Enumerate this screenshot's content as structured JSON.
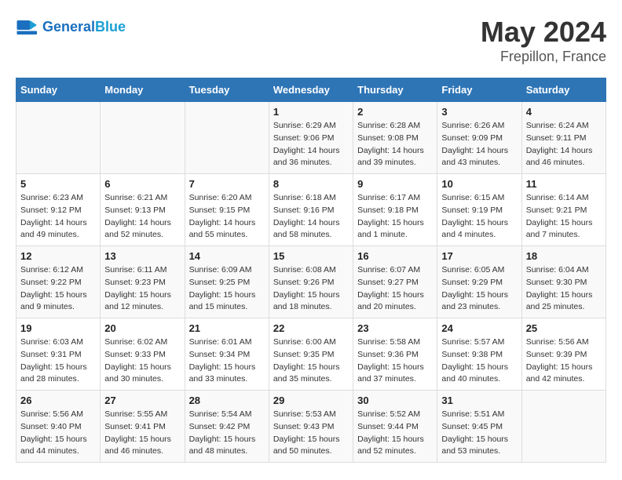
{
  "header": {
    "logo_general": "General",
    "logo_blue": "Blue",
    "month_title": "May 2024",
    "location": "Frepillon, France"
  },
  "weekdays": [
    "Sunday",
    "Monday",
    "Tuesday",
    "Wednesday",
    "Thursday",
    "Friday",
    "Saturday"
  ],
  "weeks": [
    [
      {
        "day": "",
        "sunrise": "",
        "sunset": "",
        "daylight": ""
      },
      {
        "day": "",
        "sunrise": "",
        "sunset": "",
        "daylight": ""
      },
      {
        "day": "",
        "sunrise": "",
        "sunset": "",
        "daylight": ""
      },
      {
        "day": "1",
        "sunrise": "Sunrise: 6:29 AM",
        "sunset": "Sunset: 9:06 PM",
        "daylight": "Daylight: 14 hours and 36 minutes."
      },
      {
        "day": "2",
        "sunrise": "Sunrise: 6:28 AM",
        "sunset": "Sunset: 9:08 PM",
        "daylight": "Daylight: 14 hours and 39 minutes."
      },
      {
        "day": "3",
        "sunrise": "Sunrise: 6:26 AM",
        "sunset": "Sunset: 9:09 PM",
        "daylight": "Daylight: 14 hours and 43 minutes."
      },
      {
        "day": "4",
        "sunrise": "Sunrise: 6:24 AM",
        "sunset": "Sunset: 9:11 PM",
        "daylight": "Daylight: 14 hours and 46 minutes."
      }
    ],
    [
      {
        "day": "5",
        "sunrise": "Sunrise: 6:23 AM",
        "sunset": "Sunset: 9:12 PM",
        "daylight": "Daylight: 14 hours and 49 minutes."
      },
      {
        "day": "6",
        "sunrise": "Sunrise: 6:21 AM",
        "sunset": "Sunset: 9:13 PM",
        "daylight": "Daylight: 14 hours and 52 minutes."
      },
      {
        "day": "7",
        "sunrise": "Sunrise: 6:20 AM",
        "sunset": "Sunset: 9:15 PM",
        "daylight": "Daylight: 14 hours and 55 minutes."
      },
      {
        "day": "8",
        "sunrise": "Sunrise: 6:18 AM",
        "sunset": "Sunset: 9:16 PM",
        "daylight": "Daylight: 14 hours and 58 minutes."
      },
      {
        "day": "9",
        "sunrise": "Sunrise: 6:17 AM",
        "sunset": "Sunset: 9:18 PM",
        "daylight": "Daylight: 15 hours and 1 minute."
      },
      {
        "day": "10",
        "sunrise": "Sunrise: 6:15 AM",
        "sunset": "Sunset: 9:19 PM",
        "daylight": "Daylight: 15 hours and 4 minutes."
      },
      {
        "day": "11",
        "sunrise": "Sunrise: 6:14 AM",
        "sunset": "Sunset: 9:21 PM",
        "daylight": "Daylight: 15 hours and 7 minutes."
      }
    ],
    [
      {
        "day": "12",
        "sunrise": "Sunrise: 6:12 AM",
        "sunset": "Sunset: 9:22 PM",
        "daylight": "Daylight: 15 hours and 9 minutes."
      },
      {
        "day": "13",
        "sunrise": "Sunrise: 6:11 AM",
        "sunset": "Sunset: 9:23 PM",
        "daylight": "Daylight: 15 hours and 12 minutes."
      },
      {
        "day": "14",
        "sunrise": "Sunrise: 6:09 AM",
        "sunset": "Sunset: 9:25 PM",
        "daylight": "Daylight: 15 hours and 15 minutes."
      },
      {
        "day": "15",
        "sunrise": "Sunrise: 6:08 AM",
        "sunset": "Sunset: 9:26 PM",
        "daylight": "Daylight: 15 hours and 18 minutes."
      },
      {
        "day": "16",
        "sunrise": "Sunrise: 6:07 AM",
        "sunset": "Sunset: 9:27 PM",
        "daylight": "Daylight: 15 hours and 20 minutes."
      },
      {
        "day": "17",
        "sunrise": "Sunrise: 6:05 AM",
        "sunset": "Sunset: 9:29 PM",
        "daylight": "Daylight: 15 hours and 23 minutes."
      },
      {
        "day": "18",
        "sunrise": "Sunrise: 6:04 AM",
        "sunset": "Sunset: 9:30 PM",
        "daylight": "Daylight: 15 hours and 25 minutes."
      }
    ],
    [
      {
        "day": "19",
        "sunrise": "Sunrise: 6:03 AM",
        "sunset": "Sunset: 9:31 PM",
        "daylight": "Daylight: 15 hours and 28 minutes."
      },
      {
        "day": "20",
        "sunrise": "Sunrise: 6:02 AM",
        "sunset": "Sunset: 9:33 PM",
        "daylight": "Daylight: 15 hours and 30 minutes."
      },
      {
        "day": "21",
        "sunrise": "Sunrise: 6:01 AM",
        "sunset": "Sunset: 9:34 PM",
        "daylight": "Daylight: 15 hours and 33 minutes."
      },
      {
        "day": "22",
        "sunrise": "Sunrise: 6:00 AM",
        "sunset": "Sunset: 9:35 PM",
        "daylight": "Daylight: 15 hours and 35 minutes."
      },
      {
        "day": "23",
        "sunrise": "Sunrise: 5:58 AM",
        "sunset": "Sunset: 9:36 PM",
        "daylight": "Daylight: 15 hours and 37 minutes."
      },
      {
        "day": "24",
        "sunrise": "Sunrise: 5:57 AM",
        "sunset": "Sunset: 9:38 PM",
        "daylight": "Daylight: 15 hours and 40 minutes."
      },
      {
        "day": "25",
        "sunrise": "Sunrise: 5:56 AM",
        "sunset": "Sunset: 9:39 PM",
        "daylight": "Daylight: 15 hours and 42 minutes."
      }
    ],
    [
      {
        "day": "26",
        "sunrise": "Sunrise: 5:56 AM",
        "sunset": "Sunset: 9:40 PM",
        "daylight": "Daylight: 15 hours and 44 minutes."
      },
      {
        "day": "27",
        "sunrise": "Sunrise: 5:55 AM",
        "sunset": "Sunset: 9:41 PM",
        "daylight": "Daylight: 15 hours and 46 minutes."
      },
      {
        "day": "28",
        "sunrise": "Sunrise: 5:54 AM",
        "sunset": "Sunset: 9:42 PM",
        "daylight": "Daylight: 15 hours and 48 minutes."
      },
      {
        "day": "29",
        "sunrise": "Sunrise: 5:53 AM",
        "sunset": "Sunset: 9:43 PM",
        "daylight": "Daylight: 15 hours and 50 minutes."
      },
      {
        "day": "30",
        "sunrise": "Sunrise: 5:52 AM",
        "sunset": "Sunset: 9:44 PM",
        "daylight": "Daylight: 15 hours and 52 minutes."
      },
      {
        "day": "31",
        "sunrise": "Sunrise: 5:51 AM",
        "sunset": "Sunset: 9:45 PM",
        "daylight": "Daylight: 15 hours and 53 minutes."
      },
      {
        "day": "",
        "sunrise": "",
        "sunset": "",
        "daylight": ""
      }
    ]
  ]
}
